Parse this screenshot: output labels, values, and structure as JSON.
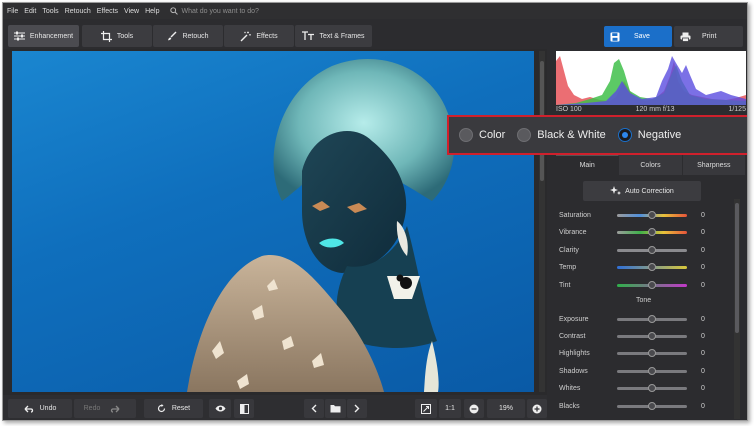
{
  "menu": [
    "File",
    "Edit",
    "Tools",
    "Retouch",
    "Effects",
    "View",
    "Help"
  ],
  "search": {
    "placeholder": "What do you want to do?"
  },
  "tabs": [
    {
      "label": "Enhancement",
      "icon": "sliders-icon",
      "active": true
    },
    {
      "label": "Tools",
      "icon": "crop-icon",
      "active": false
    },
    {
      "label": "Retouch",
      "icon": "brush-icon",
      "active": false
    },
    {
      "label": "Effects",
      "icon": "magic-wand-icon",
      "active": false
    },
    {
      "label": "Text & Frames",
      "icon": "text-icon",
      "active": false
    }
  ],
  "actions": {
    "save": "Save",
    "print": "Print"
  },
  "photo_info": {
    "iso": "ISO 100",
    "lens": "120 mm f/13",
    "shutter": "1/125"
  },
  "modes": {
    "options": [
      "Color",
      "Black & White",
      "Negative"
    ],
    "selected": "Negative"
  },
  "panel_tabs": [
    "Main",
    "Colors",
    "Sharpness"
  ],
  "auto_correction": "Auto Correction",
  "sliders": [
    {
      "label": "Saturation",
      "value": "0",
      "level": 0.5,
      "gradient": [
        "#9c9c9c",
        "#4f8fdc",
        "#e8c23a",
        "#e5533a"
      ]
    },
    {
      "label": "Vibrance",
      "value": "0",
      "level": 0.5,
      "gradient": [
        "#9c9c9c",
        "#3fb14a",
        "#e8c23a",
        "#e5533a"
      ]
    },
    {
      "label": "Clarity",
      "value": "0",
      "level": 0.5,
      "gradient": [
        "#8a8a8e",
        "#8a8a8e"
      ]
    },
    {
      "label": "Temp",
      "value": "0",
      "level": 0.5,
      "gradient": [
        "#2f6fd8",
        "#d9c83b"
      ]
    },
    {
      "label": "Tint",
      "value": "0",
      "level": 0.5,
      "gradient": [
        "#2fb04a",
        "#c238c9"
      ]
    }
  ],
  "tone": {
    "label": "Tone",
    "sliders": [
      {
        "label": "Exposure",
        "value": "0",
        "level": 0.5
      },
      {
        "label": "Contrast",
        "value": "0",
        "level": 0.5
      },
      {
        "label": "Highlights",
        "value": "0",
        "level": 0.5
      },
      {
        "label": "Shadows",
        "value": "0",
        "level": 0.5
      },
      {
        "label": "Whites",
        "value": "0",
        "level": 0.5
      },
      {
        "label": "Blacks",
        "value": "0",
        "level": 0.5
      }
    ]
  },
  "bottom": {
    "undo": "Undo",
    "redo": "Redo",
    "reset": "Reset",
    "ratio": "1:1",
    "zoom": "19%"
  },
  "colors": {
    "accent": "#1b6fc9",
    "highlight_border": "#d0202c",
    "background": "#2c2c2f"
  }
}
